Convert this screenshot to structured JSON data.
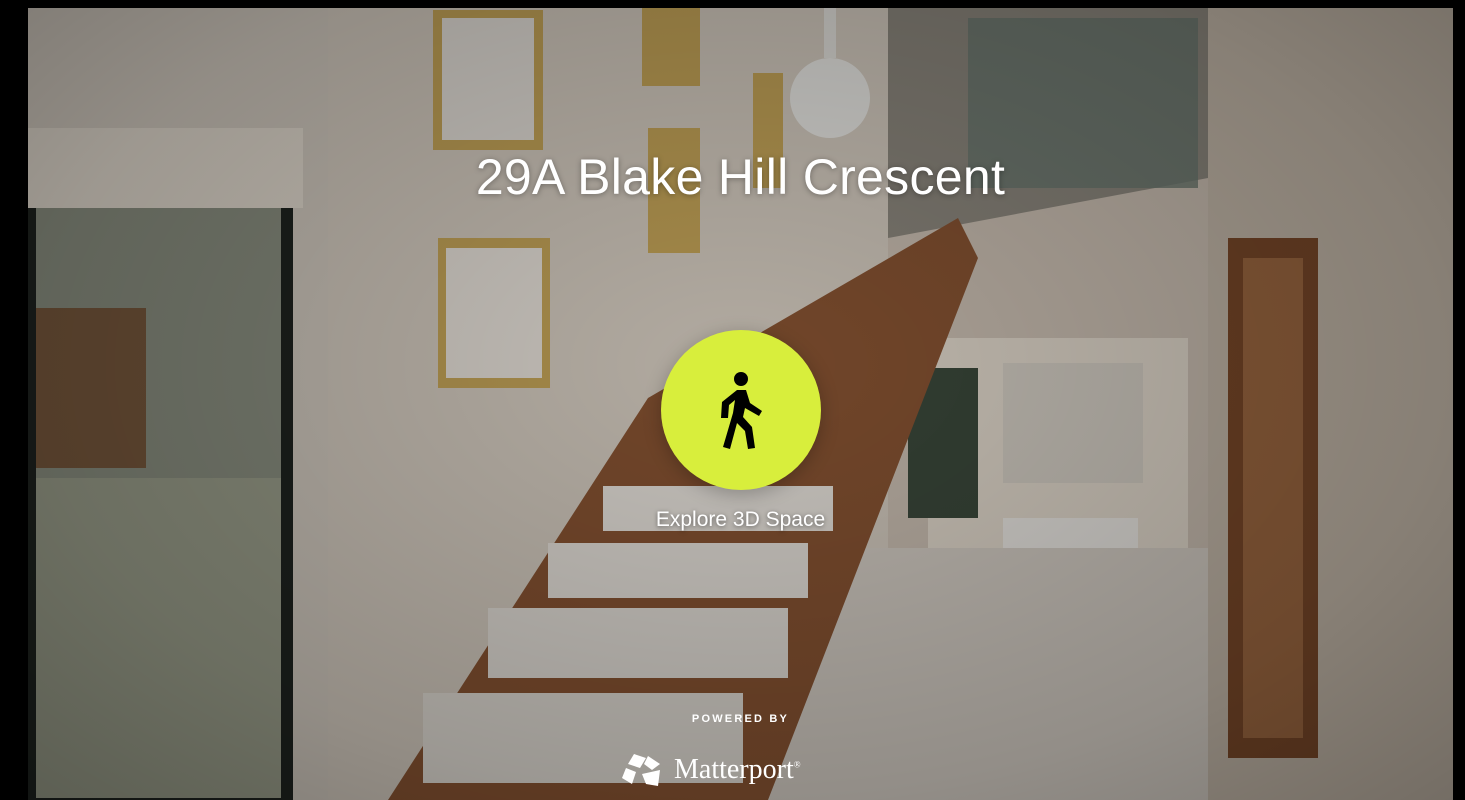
{
  "tour": {
    "title": "29A Blake Hill Crescent",
    "explore_label": "Explore 3D Space",
    "play_icon": "walking-person-icon",
    "accent_color": "#d8ee3c"
  },
  "footer": {
    "powered_by": "POWERED BY",
    "brand": "Matterport",
    "brand_mark": "®",
    "logo_icon": "matterport-logo-icon"
  }
}
